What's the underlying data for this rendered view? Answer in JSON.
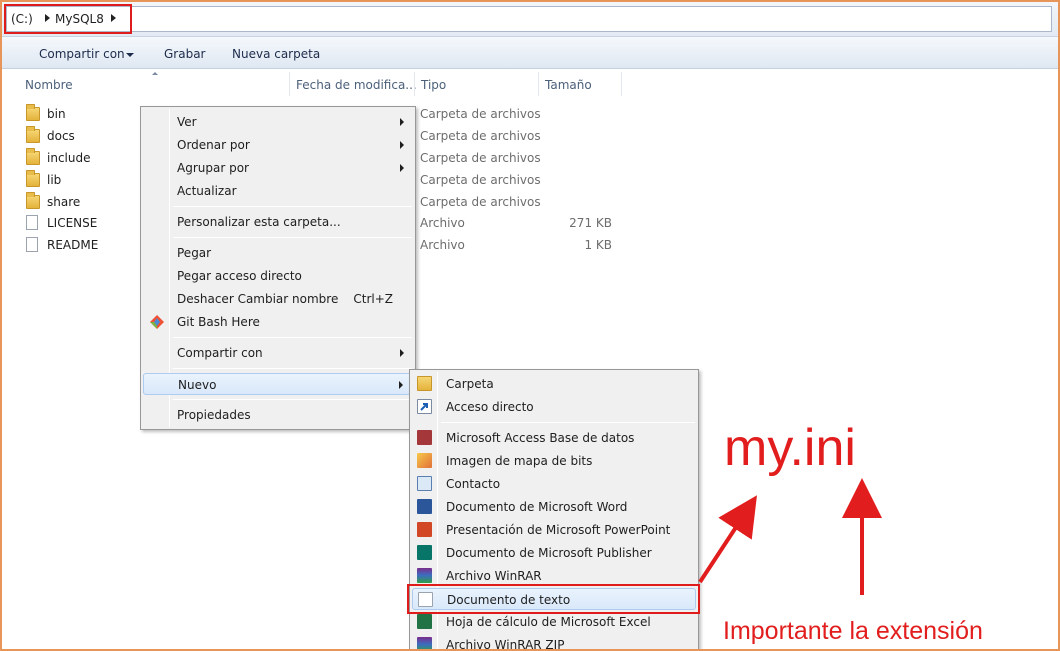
{
  "breadcrumb": {
    "drive": "(C:)",
    "folder": "MySQL8"
  },
  "toolbar": {
    "share_label": "Compartir con",
    "burn_label": "Grabar",
    "new_folder_label": "Nueva carpeta"
  },
  "columns": {
    "name": "Nombre",
    "date": "Fecha de modifica...",
    "type": "Tipo",
    "size": "Tamaño"
  },
  "files": [
    {
      "name": "bin",
      "type": "Carpeta de archivos",
      "size": "",
      "icon": "folder-icon"
    },
    {
      "name": "docs",
      "type": "Carpeta de archivos",
      "size": "",
      "icon": "folder-icon"
    },
    {
      "name": "include",
      "type": "Carpeta de archivos",
      "size": "",
      "icon": "folder-icon"
    },
    {
      "name": "lib",
      "type": "Carpeta de archivos",
      "size": "",
      "icon": "folder-icon"
    },
    {
      "name": "share",
      "type": "Carpeta de archivos",
      "size": "",
      "icon": "folder-icon"
    },
    {
      "name": "LICENSE",
      "type": "Archivo",
      "size": "271 KB",
      "icon": "file-icon"
    },
    {
      "name": "README",
      "type": "Archivo",
      "size": "1 KB",
      "icon": "file-icon"
    }
  ],
  "context_menu": {
    "ver": "Ver",
    "ordenar": "Ordenar por",
    "agrupar": "Agrupar por",
    "actualizar": "Actualizar",
    "personalizar": "Personalizar esta carpeta...",
    "pegar": "Pegar",
    "pegar_acceso": "Pegar acceso directo",
    "deshacer": "Deshacer Cambiar nombre",
    "deshacer_shortcut": "Ctrl+Z",
    "git_bash": "Git Bash Here",
    "compartir": "Compartir con",
    "nuevo": "Nuevo",
    "propiedades": "Propiedades"
  },
  "new_submenu": {
    "carpeta": "Carpeta",
    "acceso_directo": "Acceso directo",
    "access": "Microsoft Access Base de datos",
    "bitmap": "Imagen de mapa de bits",
    "contacto": "Contacto",
    "word": "Documento de Microsoft Word",
    "powerpoint": "Presentación de Microsoft PowerPoint",
    "publisher": "Documento de Microsoft Publisher",
    "winrar": "Archivo WinRAR",
    "texto": "Documento de texto",
    "excel": "Hoja de cálculo de Microsoft Excel",
    "winrar_zip": "Archivo WinRAR ZIP"
  },
  "annotations": {
    "filename": "my.ini",
    "note": "Importante la extensión"
  },
  "colors": {
    "annotation": "#e21d1d",
    "frame": "#e8955a"
  }
}
